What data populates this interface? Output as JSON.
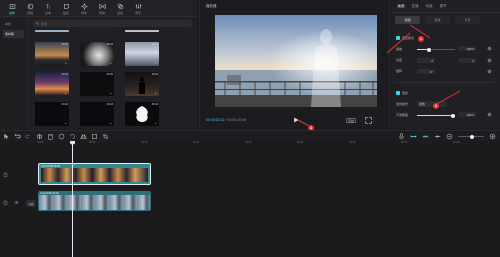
{
  "toolbar": {
    "items": [
      {
        "label": "媒体",
        "icon": "media-icon",
        "active": true
      },
      {
        "label": "音频",
        "icon": "audio-icon",
        "active": false
      },
      {
        "label": "文本",
        "icon": "text-icon",
        "active": false
      },
      {
        "label": "贴纸",
        "icon": "sticker-icon",
        "active": false
      },
      {
        "label": "特效",
        "icon": "effects-icon",
        "active": false
      },
      {
        "label": "转场",
        "icon": "transition-icon",
        "active": false
      },
      {
        "label": "滤镜",
        "icon": "filter-icon",
        "active": false
      },
      {
        "label": "调节",
        "icon": "adjust-icon",
        "active": false
      }
    ]
  },
  "side_nav": {
    "items": [
      "本地",
      "素材库"
    ]
  },
  "search": {
    "placeholder": "搜索"
  },
  "library": {
    "durations": [
      "00:05",
      "00:03",
      "00:04",
      "00:03",
      "00:05",
      "00:03",
      "00:04",
      "00:03",
      "00:04"
    ]
  },
  "player": {
    "title": "播放器",
    "timecode_current": "00:00:02:12",
    "timecode_total": "00:00:10:06",
    "ratio_label": "原始"
  },
  "inspector": {
    "tabs": [
      "画面",
      "变速",
      "动画",
      "调节"
    ],
    "sub_tabs": [
      "基础",
      "抠像",
      "背景"
    ],
    "section_blend": "混合模式",
    "scale_label": "缩放",
    "scale_value": "100%",
    "pos_label": "位置",
    "pos_x": "0",
    "pos_y": "0",
    "rot_label": "旋转",
    "rot_value": "0°",
    "section_mix": "混合",
    "mode_label": "混合模式",
    "mode_value": "滤色",
    "opacity_label": "不透明度",
    "opacity_value": "100%",
    "scale_fraction": 0.3,
    "opacity_fraction": 1.0
  },
  "markers": [
    "1",
    "2",
    "3",
    "4",
    "5"
  ],
  "timeline": {
    "ruler_ticks": [
      "00:00",
      "00:05",
      "00:10",
      "00:15",
      "00:20",
      "00:25",
      "00:30",
      "00:35",
      "00:40"
    ],
    "clip1_label": "mp4 00:00:10:06",
    "clip2_label": "mp4 00:00:10:06",
    "clip2_badge": "封面"
  },
  "colors": {
    "accent": "#3bd6e3",
    "marker": "#e3342f",
    "clip1": "#2f8a93",
    "clip2": "#2b6f79"
  }
}
